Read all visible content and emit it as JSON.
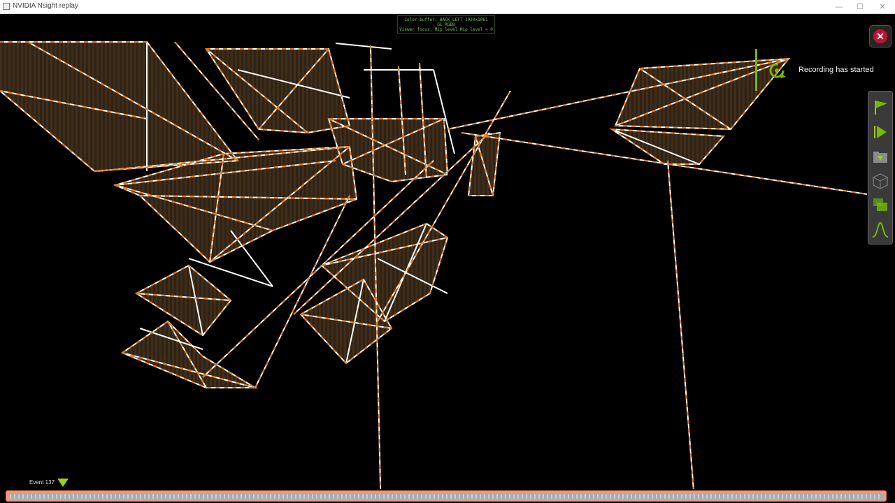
{
  "window": {
    "title": "NVIDIA Nsight replay",
    "minimize": "—",
    "maximize": "☐",
    "close": "✕"
  },
  "overlay": {
    "line1": "Color buffer: BACK_LEFT 1920x1061",
    "line2": "GL_RGB8",
    "line3": "Viewer focus: Mip level Mip level = 0"
  },
  "notification": {
    "text": "Recording has started",
    "icon": "replay-icon"
  },
  "toolbar": {
    "items": [
      {
        "icon": "flag-icon"
      },
      {
        "icon": "play-icon"
      },
      {
        "icon": "folder-download-icon"
      },
      {
        "icon": "cube-icon"
      },
      {
        "icon": "layers-icon"
      },
      {
        "icon": "bell-curve-icon"
      }
    ]
  },
  "timeline": {
    "event_label": "Event 137"
  },
  "colors": {
    "accent": "#76b900",
    "wire_orange": "#e87d1e",
    "wire_white": "#ffffff",
    "close_red": "#c8102e",
    "timeline_orange": "#f29878"
  }
}
